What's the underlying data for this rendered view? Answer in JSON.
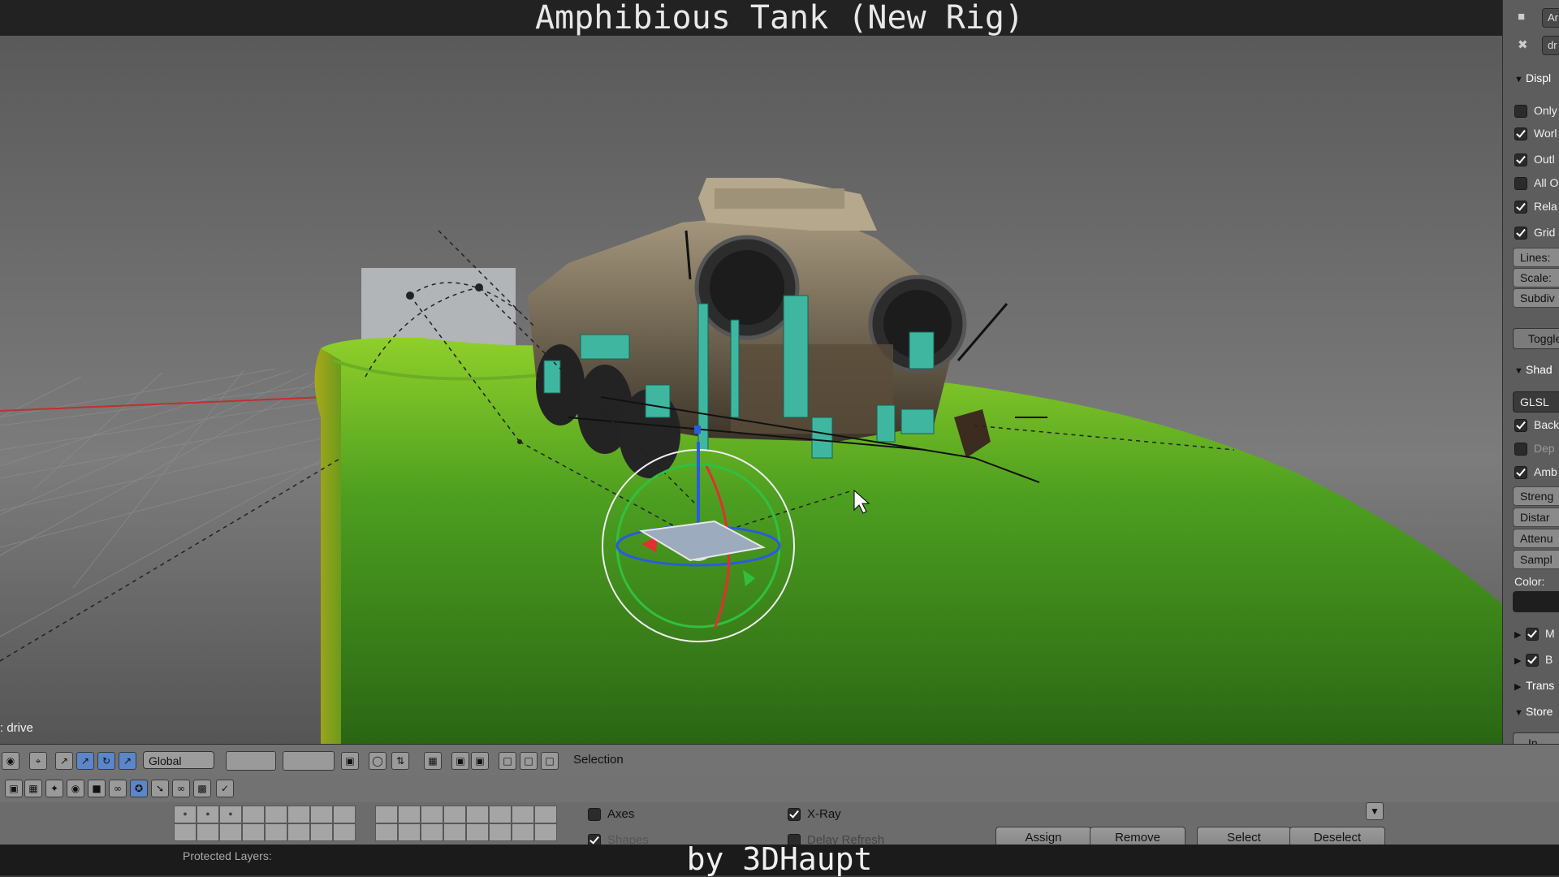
{
  "video_title": "Amphibious Tank (New Rig)",
  "video_credit": "by 3DHaupt",
  "viewport": {
    "mode_label": ": drive"
  },
  "header_toolbar": {
    "pivot_orientation": "Global",
    "selection_label": "Selection"
  },
  "right_panel": {
    "tab_labels": [
      "Ar",
      "dr"
    ],
    "display_section": "Displ",
    "display_options": [
      {
        "label": "Only",
        "checked": false
      },
      {
        "label": "Worl",
        "checked": true
      },
      {
        "label": "Outl",
        "checked": true
      },
      {
        "label": "All O",
        "checked": false
      },
      {
        "label": "Rela",
        "checked": true
      },
      {
        "label": "Grid",
        "checked": true
      }
    ],
    "grid_fields": [
      "Lines:",
      "Scale:",
      "Subdiv"
    ],
    "toggle_button": "Toggle",
    "shading_section": "Shad",
    "shading_mode": "GLSL",
    "shading_options": [
      {
        "label": "Back",
        "checked": true
      },
      {
        "label": "Dep",
        "checked": false
      },
      {
        "label": "Amb",
        "checked": true
      }
    ],
    "ao_fields": [
      "Streng",
      "Distar",
      "Attenu",
      "Sampl"
    ],
    "color_label": "Color:",
    "collapsed_sections": [
      {
        "label": "M",
        "checked": true
      },
      {
        "label": "B",
        "checked": true
      }
    ],
    "transform_section": "Trans",
    "store_section": "Store",
    "bottom_button": "In"
  },
  "bone_panel": {
    "axes_label": "Axes",
    "axes_checked": false,
    "xray_label": "X-Ray",
    "xray_checked": true,
    "shapes_label": "Shapes",
    "shapes_checked": true,
    "delay_refresh_label": "Delay Refresh",
    "delay_refresh_checked": false,
    "protected_layers_label": "Protected Layers:",
    "assign_button": "Assign",
    "remove_button": "Remove",
    "select_button": "Select",
    "deselect_button": "Deselect"
  },
  "colors": {
    "ground_green": "#3e8a1e",
    "bone_cyan": "#3fb7a0",
    "x_axis": "#e03030",
    "y_axis": "#30c040",
    "z_axis": "#2a5be0"
  }
}
